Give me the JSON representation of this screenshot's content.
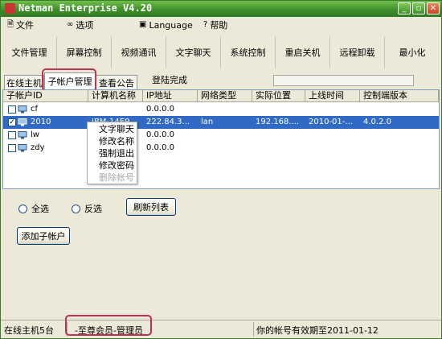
{
  "app": {
    "title": "Netman Enterprise V4.20"
  },
  "window_controls": {
    "minimize": "_",
    "restore": "▫",
    "close": "✕"
  },
  "menu": [
    {
      "label": "文件",
      "icon": "document-icon"
    },
    {
      "label": "选项",
      "icon": "glasses-icon"
    },
    {
      "label": "Language",
      "icon": "language-icon"
    },
    {
      "label": "帮助",
      "icon": "help-icon"
    }
  ],
  "toolbar": [
    "文件管理",
    "屏幕控制",
    "视频通讯",
    "文字聊天",
    "系统控制",
    "重启关机",
    "远程卸载",
    "最小化"
  ],
  "tabs": [
    {
      "label": "在线主机",
      "active": false
    },
    {
      "label": "子帐户管理",
      "active": true
    },
    {
      "label": "查看公告",
      "active": false
    }
  ],
  "status_text": "登陆完成",
  "table": {
    "headers": [
      "子帐户ID",
      "计算机名称",
      "IP地址",
      "网络类型",
      "实际位置",
      "上线时间",
      "控制端版本"
    ],
    "rows": [
      {
        "id": "cf",
        "name": "",
        "ip": "0.0.0.0",
        "net": "",
        "loc": "",
        "time": "",
        "ver": "",
        "checked": false,
        "selected": false
      },
      {
        "id": "2010",
        "name": "IBM-14E9...",
        "ip": "222.84.3...",
        "net": "lan",
        "loc": "192.168....",
        "time": "2010-01-...",
        "ver": "4.0.2.0",
        "checked": true,
        "selected": true
      },
      {
        "id": "lw",
        "name": "",
        "ip": "0.0.0.0",
        "net": "",
        "loc": "",
        "time": "",
        "ver": "",
        "checked": false,
        "selected": false
      },
      {
        "id": "zdy",
        "name": "",
        "ip": "0.0.0.0",
        "net": "",
        "loc": "",
        "time": "",
        "ver": "",
        "checked": false,
        "selected": false
      }
    ]
  },
  "context_menu": [
    {
      "label": "文字聊天",
      "disabled": false
    },
    {
      "label": "修改名称",
      "disabled": false
    },
    {
      "label": "强制退出",
      "disabled": false
    },
    {
      "label": "修改密码",
      "disabled": false
    },
    {
      "label": "删除帐号",
      "disabled": true
    }
  ],
  "controls": {
    "select_all": "全选",
    "invert": "反选",
    "refresh": "刷新列表",
    "add_sub": "添加子帐户"
  },
  "statusbar": {
    "online": "在线主机5台",
    "role": "-至尊会员-管理员",
    "expire": "你的帐号有效期至2011-01-12"
  },
  "colors": {
    "title_green": "#3f8f2c",
    "selection": "#316ac5",
    "highlight_box": "#c0334f"
  }
}
